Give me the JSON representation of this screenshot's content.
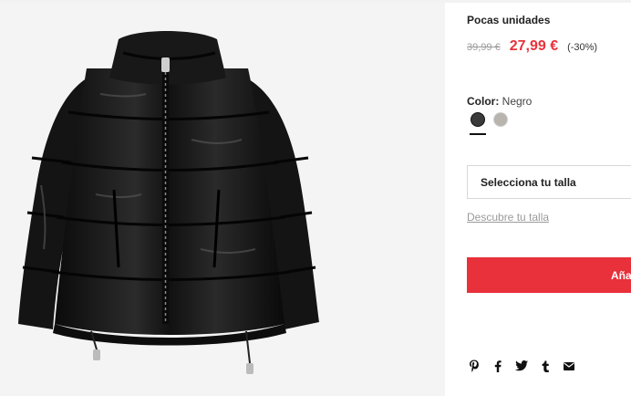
{
  "product": {
    "stock_label": "Pocas unidades",
    "old_price": "39,99 €",
    "new_price": "27,99 €",
    "discount": "(-30%)",
    "color_label": "Color:",
    "color_value": "Negro",
    "colors": [
      {
        "name": "negro",
        "hex": "#3a3a3a",
        "selected": true
      },
      {
        "name": "gris",
        "hex": "#b9b4ad",
        "selected": false
      }
    ],
    "size_select_label": "Selecciona tu talla",
    "size_guide_link": "Descubre tu talla",
    "add_to_cart_label": "Añadir a la b"
  },
  "share": {
    "icons": [
      "pinterest-icon",
      "facebook-icon",
      "twitter-icon",
      "tumblr-icon",
      "mail-icon"
    ]
  },
  "theme": {
    "accent": "#e8323c",
    "button_bg": "#e8313b",
    "image_bg": "#f4f4f4"
  }
}
